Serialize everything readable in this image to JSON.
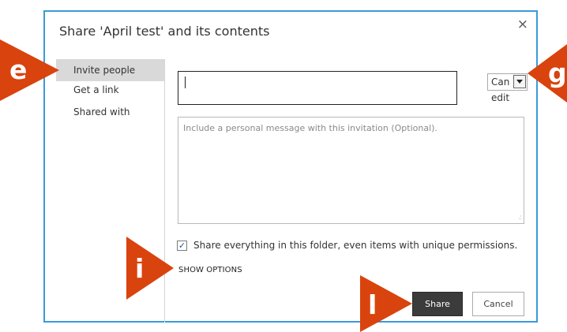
{
  "dialog": {
    "title": "Share 'April test' and its contents",
    "close_glyph": "×"
  },
  "sidebar": {
    "items": [
      {
        "label": "Invite people",
        "active": true
      },
      {
        "label": "Get a link",
        "active": false
      },
      {
        "label": "Shared with",
        "active": false
      }
    ]
  },
  "invite": {
    "value": "",
    "permission": "Can edit"
  },
  "message": {
    "placeholder": "Include a personal message with this invitation (Optional)."
  },
  "share_all": {
    "checked": true,
    "label": "Share everything in this folder, even items with unique permissions."
  },
  "show_options_label": "SHOW OPTIONS",
  "buttons": {
    "share": "Share",
    "cancel": "Cancel"
  },
  "callouts": {
    "e": "e",
    "g": "g",
    "i": "i",
    "l": "l"
  },
  "colors": {
    "callout": "#d9430e",
    "dialog_border": "#3a9ad9",
    "share_button": "#3b3b3b",
    "sidebar_active": "#d9d9d9"
  },
  "icons": {
    "close": "close-icon",
    "dropdown": "chevron-down-icon",
    "checkbox": "checkbox-checked-icon",
    "resize": "resize-grip-icon"
  }
}
